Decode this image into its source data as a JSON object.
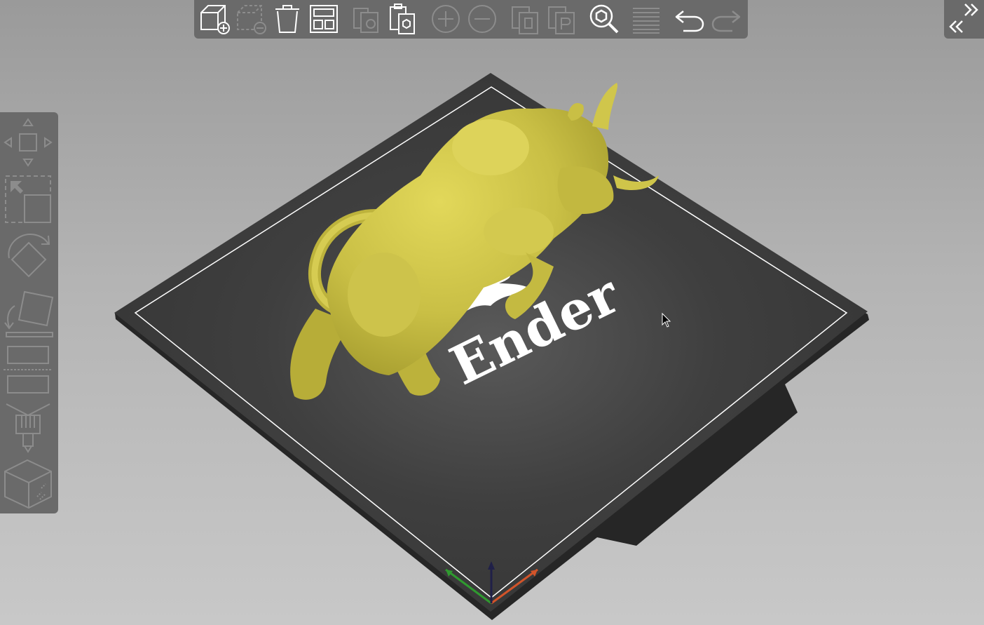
{
  "bed_logo": {
    "text": "Ender"
  },
  "toolbar": {
    "items": [
      {
        "name": "add-object",
        "icon": "cube-plus-icon",
        "enabled": true
      },
      {
        "name": "delete-selected",
        "icon": "dashed-cube-minus-icon",
        "enabled": false
      },
      {
        "name": "delete-all",
        "icon": "trash-icon",
        "enabled": true
      },
      {
        "name": "arrange",
        "icon": "arrange-grid-icon",
        "enabled": true
      },
      {
        "name": "copy",
        "icon": "copy-icon",
        "enabled": false
      },
      {
        "name": "paste",
        "icon": "paste-icon",
        "enabled": true
      },
      {
        "name": "add-instance",
        "icon": "plus-circle-icon",
        "enabled": false
      },
      {
        "name": "remove-instance",
        "icon": "minus-circle-icon",
        "enabled": false
      },
      {
        "name": "split-objects",
        "icon": "split-objects-icon",
        "enabled": false
      },
      {
        "name": "split-parts",
        "icon": "split-parts-icon",
        "enabled": false
      },
      {
        "name": "search",
        "icon": "search-icon",
        "enabled": true
      },
      {
        "name": "layers-editing",
        "icon": "layers-icon",
        "enabled": false
      },
      {
        "name": "undo",
        "icon": "undo-icon",
        "enabled": true
      },
      {
        "name": "redo",
        "icon": "redo-icon",
        "enabled": false
      }
    ]
  },
  "gizmos": [
    {
      "name": "move",
      "icon": "move-arrows-icon"
    },
    {
      "name": "scale",
      "icon": "scale-icon"
    },
    {
      "name": "rotate",
      "icon": "rotate-icon"
    },
    {
      "name": "place-on-face",
      "icon": "place-on-face-icon"
    },
    {
      "name": "cut",
      "icon": "cut-icon"
    },
    {
      "name": "paint-supports",
      "icon": "paint-brush-icon"
    },
    {
      "name": "seam-painting",
      "icon": "wireframe-cube-icon"
    }
  ],
  "colors": {
    "background_top": "#9a9a9a",
    "background_bottom": "#c8c8c8",
    "panel": "#6a6a6a",
    "icon_enabled": "#ffffff",
    "icon_disabled": "#8c8c8c",
    "bed": "#3a3a3a",
    "bed_edge": "#262626",
    "bed_outline": "#ffffff",
    "model": "#c9bf45",
    "axis_x": "#d2542a",
    "axis_y": "#2f9a2f",
    "axis_z": "#202048"
  }
}
